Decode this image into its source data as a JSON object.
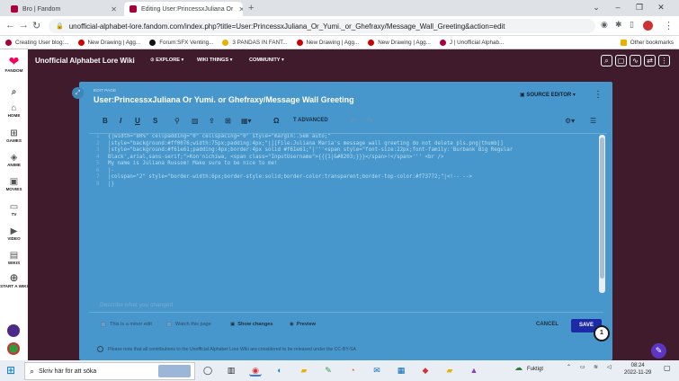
{
  "browser": {
    "tabs": [
      {
        "title": "Bro | Fandom"
      },
      {
        "title": "Editing User:PrincessxJuliana Or"
      }
    ],
    "url": "unofficial-alphabet-lore.fandom.com/index.php?title=User:PrincessxJuliana_Or_Yumi._or_Ghefraxy/Message_Wall_Greeting&action=edit",
    "bookmarks": [
      {
        "label": "Creating User blog:...",
        "color": "#a7003b"
      },
      {
        "label": "New Drawing | Agg...",
        "color": "#c00"
      },
      {
        "label": "Forum:SFX Venting...",
        "color": "#111"
      },
      {
        "label": "3 PANDAS IN FANT...",
        "color": "#e8b100"
      },
      {
        "label": "New Drawing | Agg...",
        "color": "#c00"
      },
      {
        "label": "New Drawing | Agg...",
        "color": "#c00"
      },
      {
        "label": "J | Unofficial Alphab...",
        "color": "#a7003b"
      }
    ],
    "other_bookmarks": "Other bookmarks"
  },
  "fandom_rail": {
    "logo_label": "FANDOM",
    "items": [
      {
        "label": "HOME",
        "icon": "home-icon"
      },
      {
        "label": "GAMES",
        "icon": "gamepad-icon"
      },
      {
        "label": "ANIME",
        "icon": "anime-icon"
      },
      {
        "label": "MOVIES",
        "icon": "movie-icon"
      },
      {
        "label": "TV",
        "icon": "tv-icon"
      },
      {
        "label": "VIDEO",
        "icon": "video-icon"
      },
      {
        "label": "WIKIS",
        "icon": "wikis-icon"
      },
      {
        "label": "START A WIKI",
        "icon": "plus-icon"
      }
    ]
  },
  "site": {
    "title": "Unofficial Alphabet Lore Wiki",
    "nav": [
      "EXPLORE",
      "WIKI THINGS",
      "COMMUNITY"
    ]
  },
  "editor": {
    "breadcrumb": "EDIT PAGE",
    "title": "User:PrincessxJuliana Or Yumi. or Ghefraxy/Message Wall Greeting",
    "source_editor_label": "SOURCE EDITOR",
    "advanced_label": "ADVANCED",
    "code_lines": [
      "{|width=\"80%\" cellpadding=\"0\" cellspacing=\"0\" style=\"margin:.5em auto;\"",
      "|style=\"background:#ff0076;width:75px;padding:4px;\"|[[File:Juliana Maria's message wall greeting do not delete pls.png|thumb]]",
      "|style=\"background:#f61e61;padding:4px;border:4px solid #f61e61;\"|'''<span style=\"font-size:22px;font-family:'Burbank Big Regular",
      "Black',arial,sans-serif;\">Kon'nichiwa, <span class=\"InputUsername\">{{{1|&#8203;}}}</span>!</span>''' <br />",
      "My name is Juliana Russom! Make sure to be nice to me!",
      "|-",
      "|colspan=\"2\" style=\"border-width:6px;border-style:solid;border-color:transparent;border-top-color:#f73772;\"|<!-- -->",
      "|}"
    ],
    "summary_placeholder": "Describe what you changed",
    "minor_edit_label": "This is a minor edit",
    "watch_label": "Watch this page",
    "show_changes_label": "Show changes",
    "preview_label": "Preview",
    "cancel_label": "CANCEL",
    "save_label": "SAVE",
    "notification_count": "1",
    "license_text": "Please note that all contributions to the Unofficial Alphabet Lore Wiki are considered to be released under the CC-BY-SA"
  },
  "taskbar": {
    "search_placeholder": "Skriv här för att söka",
    "weather": "Fuktigt",
    "time": "08:24",
    "date": "2022-11-29"
  }
}
